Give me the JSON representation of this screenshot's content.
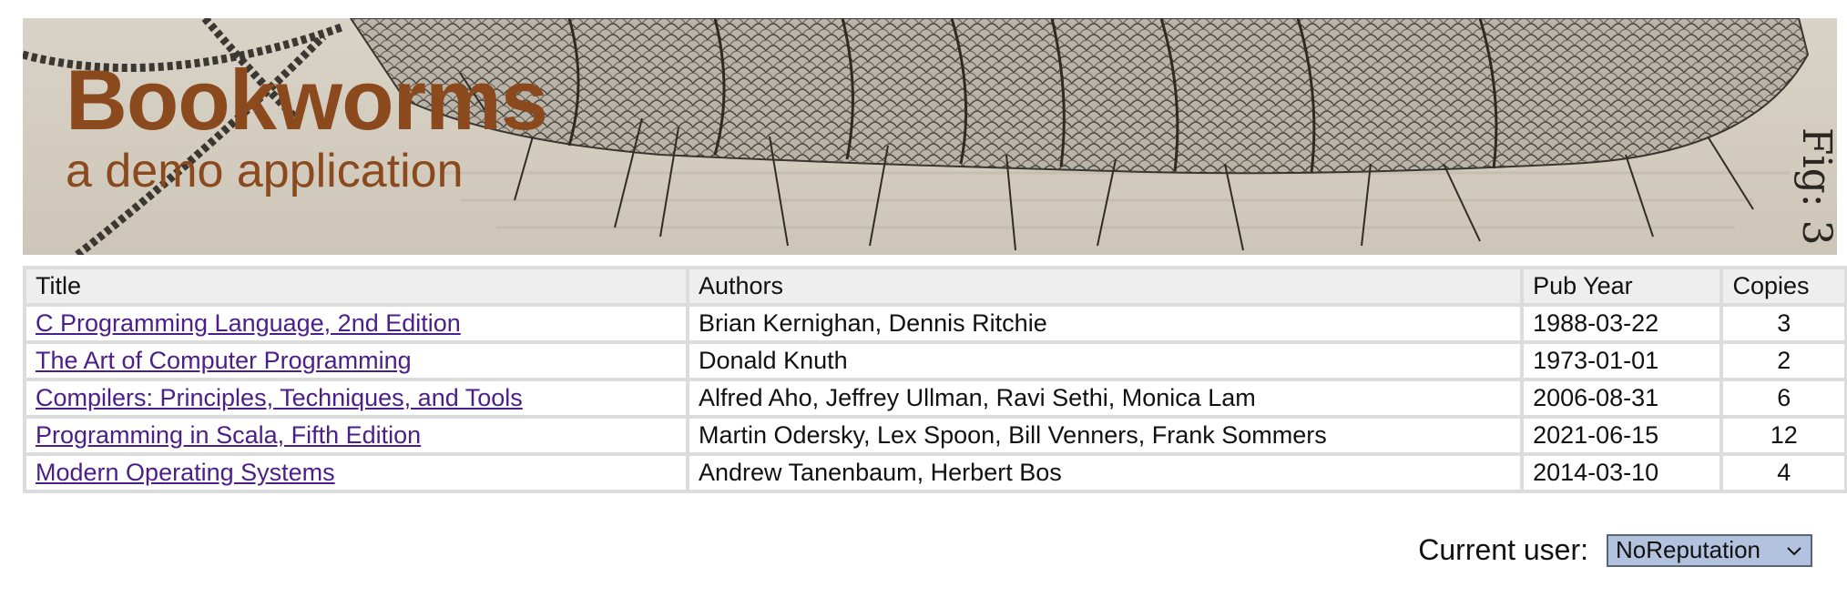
{
  "header": {
    "title": "Bookworms",
    "subtitle": "a demo application",
    "figure_label": "Fig: 3"
  },
  "table": {
    "columns": [
      "Title",
      "Authors",
      "Pub Year",
      "Copies"
    ],
    "rows": [
      {
        "title": "C Programming Language, 2nd Edition",
        "authors": "Brian Kernighan, Dennis Ritchie",
        "pub_year": "1988-03-22",
        "copies": "3"
      },
      {
        "title": "The Art of Computer Programming",
        "authors": "Donald Knuth",
        "pub_year": "1973-01-01",
        "copies": "2"
      },
      {
        "title": "Compilers: Principles, Techniques, and Tools",
        "authors": "Alfred Aho, Jeffrey Ullman, Ravi Sethi, Monica Lam",
        "pub_year": "2006-08-31",
        "copies": "6"
      },
      {
        "title": "Programming in Scala, Fifth Edition",
        "authors": "Martin Odersky, Lex Spoon, Bill Venners, Frank Sommers",
        "pub_year": "2021-06-15",
        "copies": "12"
      },
      {
        "title": "Modern Operating Systems",
        "authors": "Andrew Tanenbaum, Herbert Bos",
        "pub_year": "2014-03-10",
        "copies": "4"
      }
    ]
  },
  "user": {
    "label": "Current user:",
    "selected": "NoReputation"
  },
  "colors": {
    "title_brown": "#8b4a1e",
    "link_purple": "#4b1e8a",
    "select_bg": "#b3c2de",
    "header_bg": "#eeeeee",
    "border": "#dcdcdc"
  },
  "icons": {
    "select_chevron": "chevron-down-icon"
  }
}
